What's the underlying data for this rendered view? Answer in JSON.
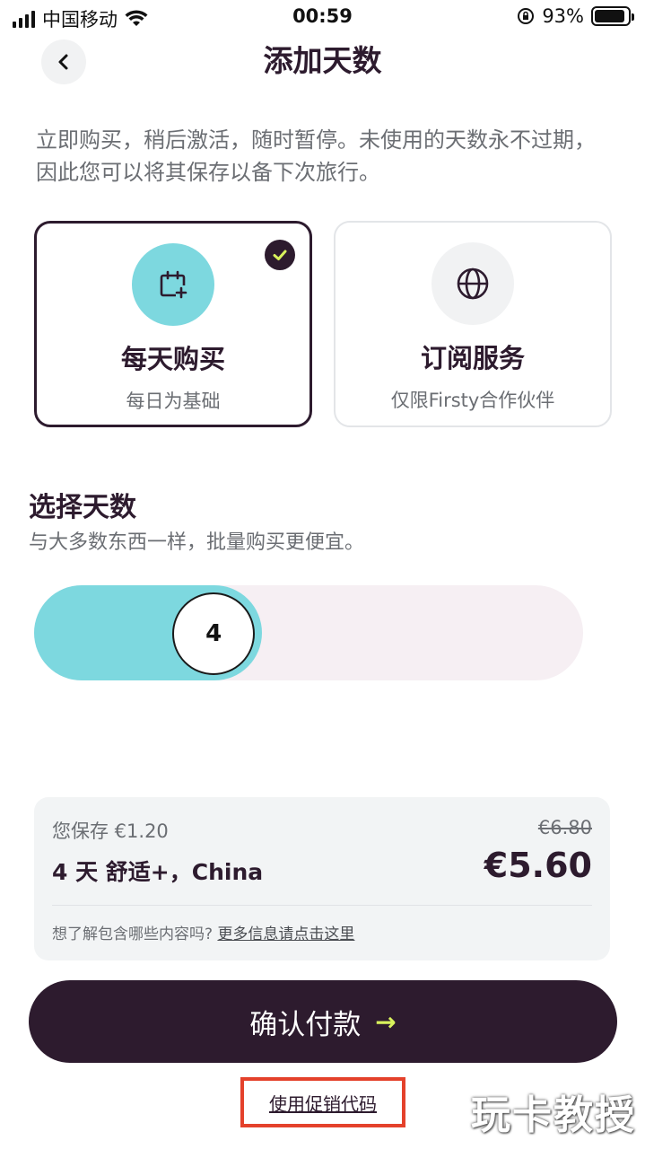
{
  "status_bar": {
    "carrier": "中国移动",
    "time": "00:59",
    "battery_percent": "93%",
    "battery_level": 0.93
  },
  "header": {
    "title": "添加天数"
  },
  "intro": "立即购买，稍后激活，随时暂停。未使用的天数永不过期，因此您可以将其保存以备下次旅行。",
  "plans": [
    {
      "title": "每天购买",
      "subtitle": "每日为基础",
      "icon": "calendar-plus-icon",
      "selected": true
    },
    {
      "title": "订阅服务",
      "subtitle": "仅限Firsty合作伙伴",
      "icon": "globe-icon",
      "selected": false
    }
  ],
  "days": {
    "title": "选择天数",
    "subtitle": "与大多数东西一样，批量购买更便宜。",
    "value": "4",
    "level": 0.29
  },
  "summary": {
    "savings": "您保存 €1.20",
    "original_price": "€6.80",
    "plan": "4 天 舒适+，China",
    "price": "€5.60",
    "info_question": "想了解包含哪些内容吗?",
    "info_link": "更多信息请点击这里"
  },
  "actions": {
    "confirm_label": "确认付款",
    "confirm_arrow": "→",
    "promo_label": "使用促销代码"
  },
  "watermark": "玩卡教授",
  "colors": {
    "primary": "#2d1b2e",
    "accent": "#7dd8df",
    "highlight": "#d8f25c",
    "annotation": "#e4412b"
  }
}
